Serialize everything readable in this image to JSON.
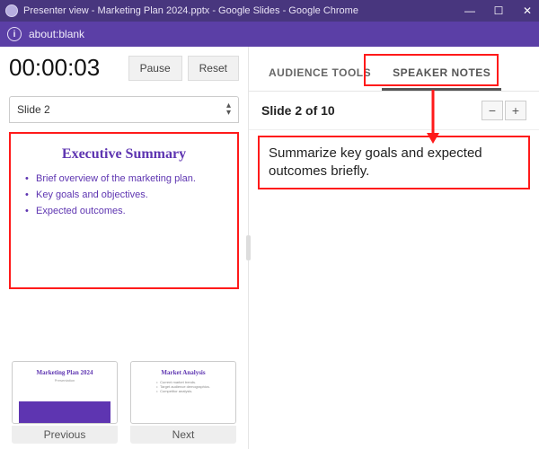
{
  "window": {
    "title": "Presenter view - Marketing Plan 2024.pptx - Google Slides - Google Chrome"
  },
  "address": {
    "url": "about:blank"
  },
  "timer": {
    "elapsed": "00:00:03",
    "pause_label": "Pause",
    "reset_label": "Reset"
  },
  "slide_selector": {
    "label": "Slide 2"
  },
  "preview": {
    "title": "Executive Summary",
    "bullets": [
      "Brief overview of the marketing plan.",
      "Key goals and objectives.",
      "Expected outcomes."
    ]
  },
  "nav": {
    "prev_label": "Previous",
    "next_label": "Next",
    "prev_thumb": {
      "title": "Marketing Plan 2024",
      "subtitle": "Presentation"
    },
    "next_thumb": {
      "title": "Market Analysis",
      "items": [
        "Current market trends.",
        "Target audience demographics.",
        "Competitor analysis."
      ]
    }
  },
  "tabs": {
    "audience": "AUDIENCE TOOLS",
    "speaker": "SPEAKER NOTES"
  },
  "slide_header": {
    "position": "Slide 2 of 10"
  },
  "notes": {
    "text": "Summarize key goals and expected outcomes briefly."
  }
}
